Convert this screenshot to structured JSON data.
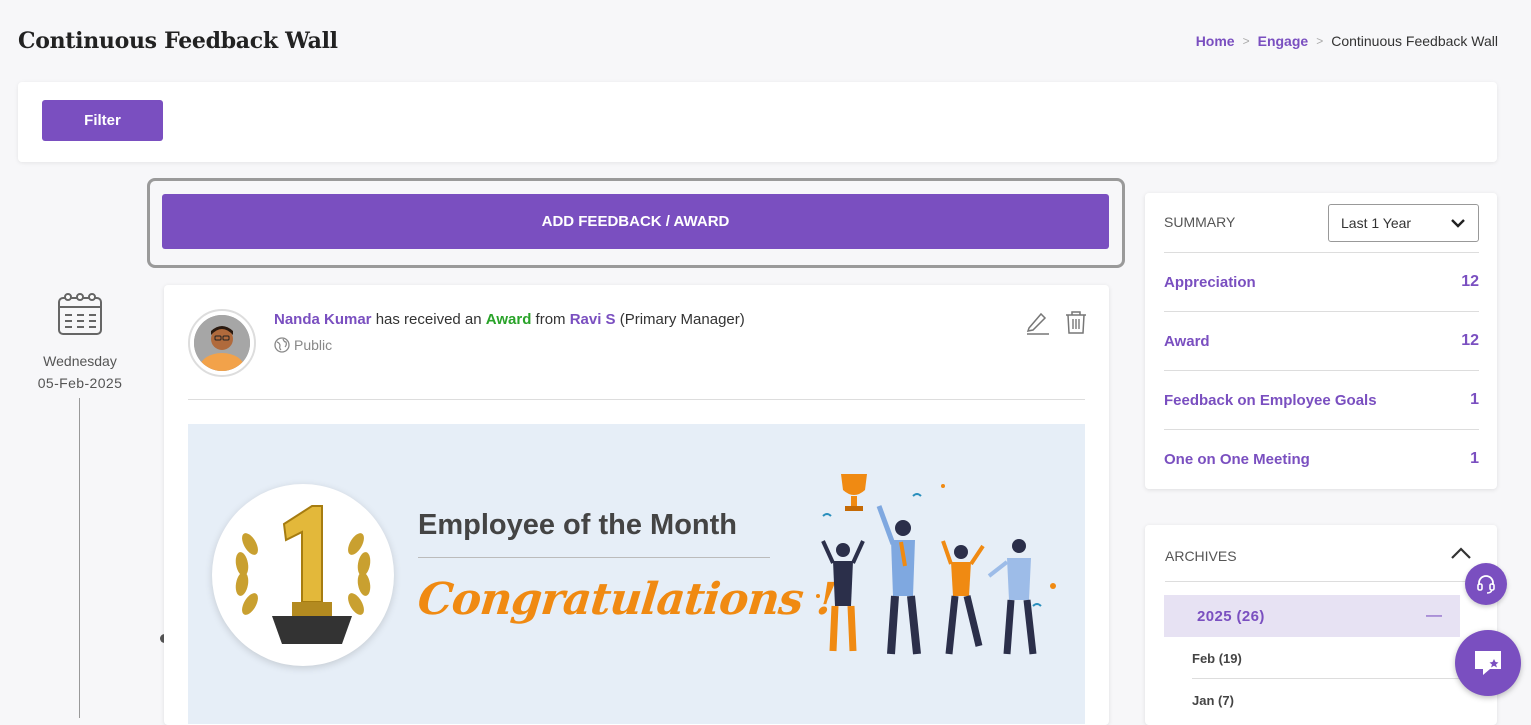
{
  "header": {
    "title": "Continuous Feedback Wall",
    "breadcrumb": {
      "home": "Home",
      "engage": "Engage",
      "current": "Continuous Feedback Wall",
      "separator": ">"
    }
  },
  "filter": {
    "button_label": "Filter"
  },
  "add": {
    "button_label": "ADD FEEDBACK / AWARD"
  },
  "timeline": {
    "day": "Wednesday",
    "date": "05-Feb-2025"
  },
  "post": {
    "recipient": "Nanda Kumar",
    "text_received": " has received an ",
    "type": "Award",
    "text_from": " from ",
    "sender": "Ravi S",
    "sender_role": " (Primary Manager)",
    "visibility": "Public",
    "banner_title": "Employee of the Month",
    "banner_script": "Congratulations !"
  },
  "summary": {
    "label": "SUMMARY",
    "period": "Last 1 Year",
    "rows": [
      {
        "label": "Appreciation",
        "count": "12"
      },
      {
        "label": "Award",
        "count": "12"
      },
      {
        "label": "Feedback on Employee Goals",
        "count": "1"
      },
      {
        "label": "One on One Meeting",
        "count": "1"
      }
    ]
  },
  "archives": {
    "label": "ARCHIVES",
    "year": "2025 (26)",
    "months": [
      "Feb (19)",
      "Jan (7)"
    ]
  },
  "colors": {
    "accent": "#7a4fc0",
    "award_green": "#29a329",
    "script_orange": "#f08a12"
  }
}
